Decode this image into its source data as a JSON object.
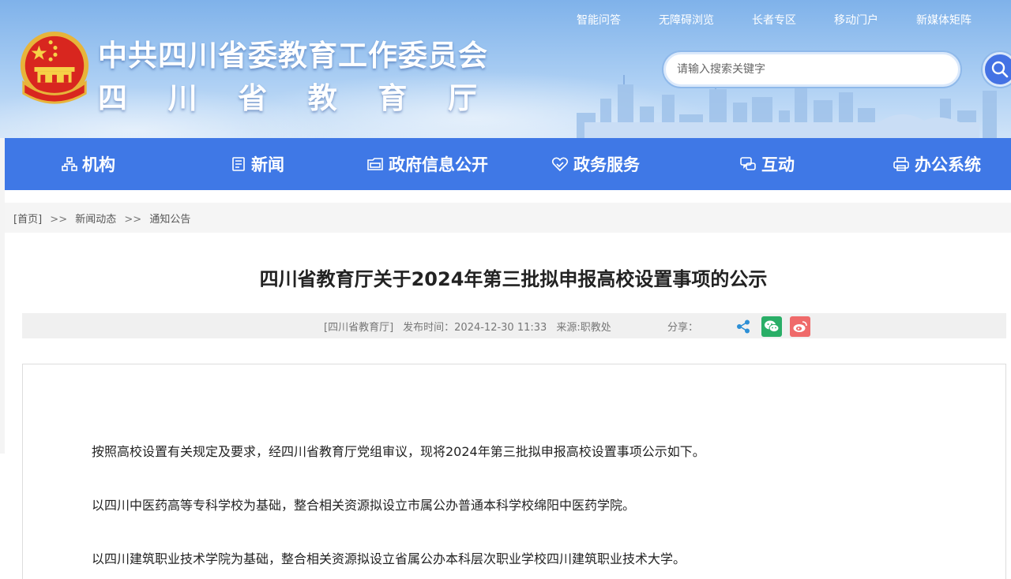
{
  "header": {
    "title_line1": "中共四川省委教育工作委员会",
    "title_line2_chars": [
      "四",
      "川",
      "省",
      "教",
      "育",
      "厅"
    ],
    "top_links": [
      "智能问答",
      "无障碍浏览",
      "长者专区",
      "移动门户",
      "新媒体矩阵"
    ],
    "search_placeholder": "请输入搜索关键字"
  },
  "nav": {
    "items": [
      {
        "label": "机构",
        "icon": "org-chart-icon"
      },
      {
        "label": "新闻",
        "icon": "document-icon"
      },
      {
        "label": "政府信息公开",
        "icon": "folder-icon"
      },
      {
        "label": "政务服务",
        "icon": "heart-hand-icon"
      },
      {
        "label": "互动",
        "icon": "chat-icon"
      },
      {
        "label": "办公系统",
        "icon": "printer-icon"
      }
    ]
  },
  "breadcrumb": {
    "home": "[首页]",
    "sep": ">>",
    "level1": "新闻动态",
    "level2": "通知公告"
  },
  "article": {
    "title": "四川省教育厅关于2024年第三批拟申报高校设置事项的公示",
    "source_tag": "[四川省教育厅]",
    "publish_time": "发布时间：2024-12-30 11:33",
    "origin": "来源:职教处",
    "share_label": "分享：",
    "paragraphs": [
      "按照高校设置有关规定及要求，经四川省教育厅党组审议，现将2024年第三批拟申报高校设置事项公示如下。",
      "以四川中医药高等专科学校为基础，整合相关资源拟设立市属公办普通本科学校绵阳中医药学院。",
      "以四川建筑职业技术学院为基础，整合相关资源拟设立省属公办本科层次职业学校四川建筑职业技术大学。"
    ]
  },
  "colors": {
    "nav_bg": "#3f78e6",
    "search_btn": "#4472e4",
    "wechat": "#2aae67",
    "weibo": "#ef6a6a",
    "share": "#2c8fd6"
  }
}
